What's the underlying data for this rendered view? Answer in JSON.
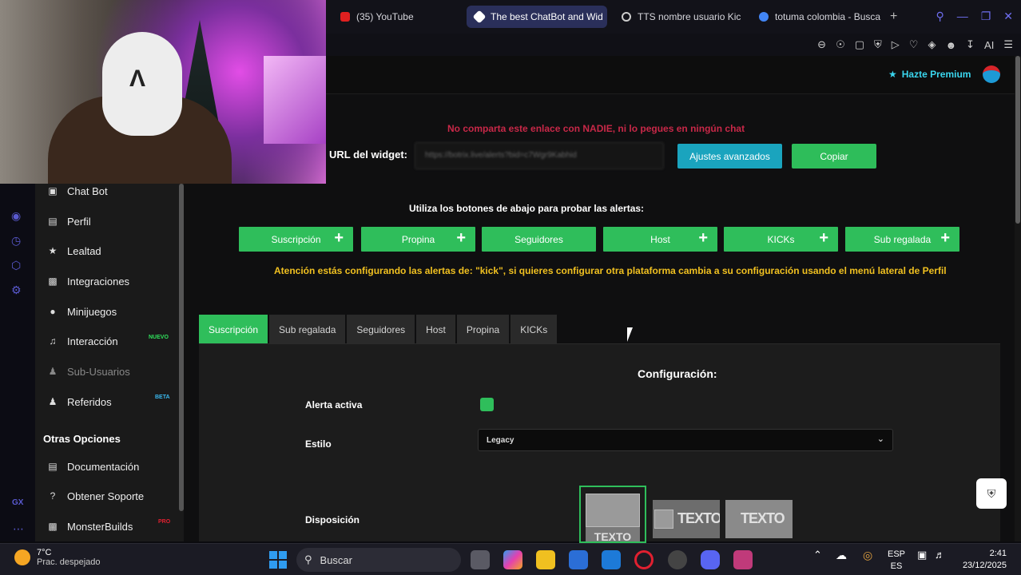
{
  "browser": {
    "tabs": [
      {
        "label": "(35) YouTube",
        "color": "#e02020",
        "active": false
      },
      {
        "label": "The best ChatBot and Wid",
        "color": "#ffffff",
        "active": true
      },
      {
        "label": "TTS nombre usuario Kic",
        "color": "#cccccc",
        "active": false
      },
      {
        "label": "totuma colombia - Busca",
        "color": "#4285f4",
        "active": false
      }
    ],
    "toolbar_ai": "AI"
  },
  "header": {
    "premium_label": "Hazte Premium"
  },
  "sidebar": {
    "items": [
      {
        "label": "Chat Bot",
        "icon": "robot-icon"
      },
      {
        "label": "Perfil",
        "icon": "id-card-icon"
      },
      {
        "label": "Lealtad",
        "icon": "trophy-icon"
      },
      {
        "label": "Integraciones",
        "icon": "integration-icon"
      },
      {
        "label": "Minijuegos",
        "icon": "gamepad-icon"
      },
      {
        "label": "Interacción",
        "icon": "music-icon",
        "badge": "NUEVO"
      },
      {
        "label": "Sub-Usuarios",
        "icon": "users-icon"
      },
      {
        "label": "Referidos",
        "icon": "referral-icon",
        "badge": "BETA"
      }
    ],
    "section_title": "Otras Opciones",
    "other": [
      {
        "label": "Documentación",
        "icon": "book-icon"
      },
      {
        "label": "Obtener Soporte",
        "icon": "question-icon"
      },
      {
        "label": "MonsterBuilds",
        "icon": "laptop-icon",
        "badge": "PRO"
      }
    ]
  },
  "widget": {
    "warning": "No comparta este enlace con NADIE, ni lo pegues en ningún chat",
    "url_label": "URL del widget:",
    "url_value": "https://botrix.live/alerts?bid=c7Wgr9Kabhid",
    "advanced_button": "Ajustes avanzados",
    "copy_button": "Copiar"
  },
  "test": {
    "label": "Utiliza los botones de abajo para probar las alertas:",
    "buttons": [
      "Suscripción",
      "Propina",
      "Seguidores",
      "Host",
      "KICKs",
      "Sub regalada"
    ],
    "attention": "Atención estás configurando las alertas de: \"kick\", si quieres configurar otra plataforma cambia a su configuración usando el menú lateral de Perfil"
  },
  "config_tabs": [
    "Suscripción",
    "Sub regalada",
    "Seguidores",
    "Host",
    "Propina",
    "KICKs"
  ],
  "config": {
    "title": "Configuración:",
    "active_label": "Alerta activa",
    "style_label": "Estilo",
    "style_value": "Legacy",
    "layout_label": "Disposición",
    "layout_text": "TEXTO"
  },
  "taskbar": {
    "temp": "7°C",
    "weather": "Prac. despejado",
    "search_placeholder": "Buscar",
    "lang_1": "ESP",
    "lang_2": "ES",
    "time": "2:41",
    "date": "23/12/2025"
  },
  "rail_label": "GX"
}
